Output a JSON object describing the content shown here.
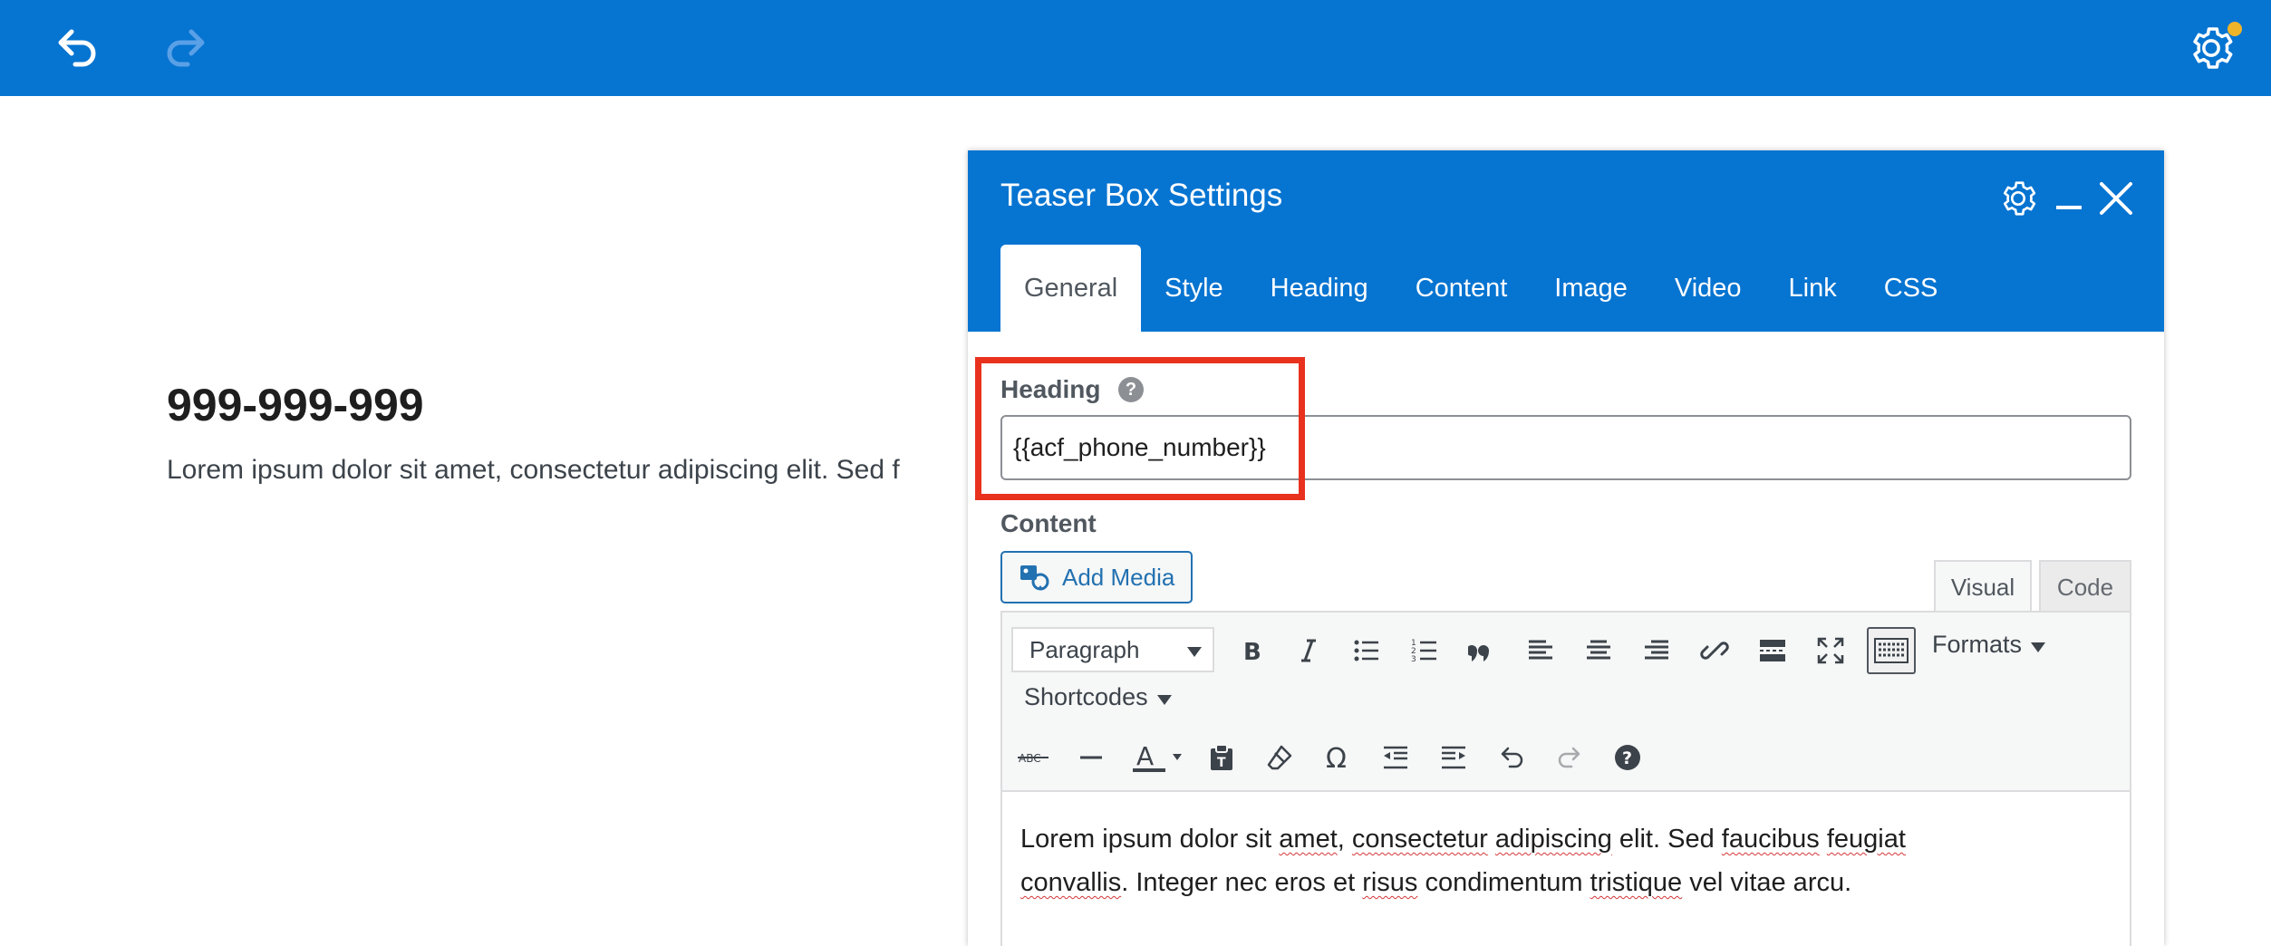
{
  "topbar": {
    "undo": "undo-icon",
    "redo": "redo-icon",
    "settings": "gear-icon",
    "notification_color": "#f0b429",
    "bg_color": "#0674d1"
  },
  "page": {
    "heading": "999-999-999",
    "text": "Lorem ipsum dolor sit amet, consectetur adipiscing elit. Sed f"
  },
  "panel": {
    "title": "Teaser Box Settings",
    "tabs": [
      {
        "label": "General",
        "active": true
      },
      {
        "label": "Style"
      },
      {
        "label": "Heading"
      },
      {
        "label": "Content"
      },
      {
        "label": "Image"
      },
      {
        "label": "Video"
      },
      {
        "label": "Link"
      },
      {
        "label": "CSS"
      }
    ],
    "heading_field": {
      "label": "Heading",
      "help": "?",
      "value": "{{acf_phone_number}}"
    },
    "content_field": {
      "label": "Content",
      "add_media": "Add Media",
      "mode_visual": "Visual",
      "mode_code": "Code",
      "format_select": "Paragraph",
      "formats": "Formats",
      "shortcodes": "Shortcodes",
      "text_color_letter": "A",
      "omega": "Ω",
      "text": {
        "w1": "Lorem ipsum dolor sit ",
        "w2": "amet",
        "w3": ", ",
        "w4": "consectetur",
        "w5": " ",
        "w6": "adipiscing",
        "w7": " elit. Sed ",
        "w8": "faucibus",
        "w9": " ",
        "w10": "feugiat",
        "w11": "convallis",
        "w12": ". Integer nec eros et ",
        "w13": "risus",
        "w14": " condimentum ",
        "w15": "tristique",
        "w16": " vel vitae arcu."
      }
    }
  },
  "highlight_color": "#e8321e"
}
